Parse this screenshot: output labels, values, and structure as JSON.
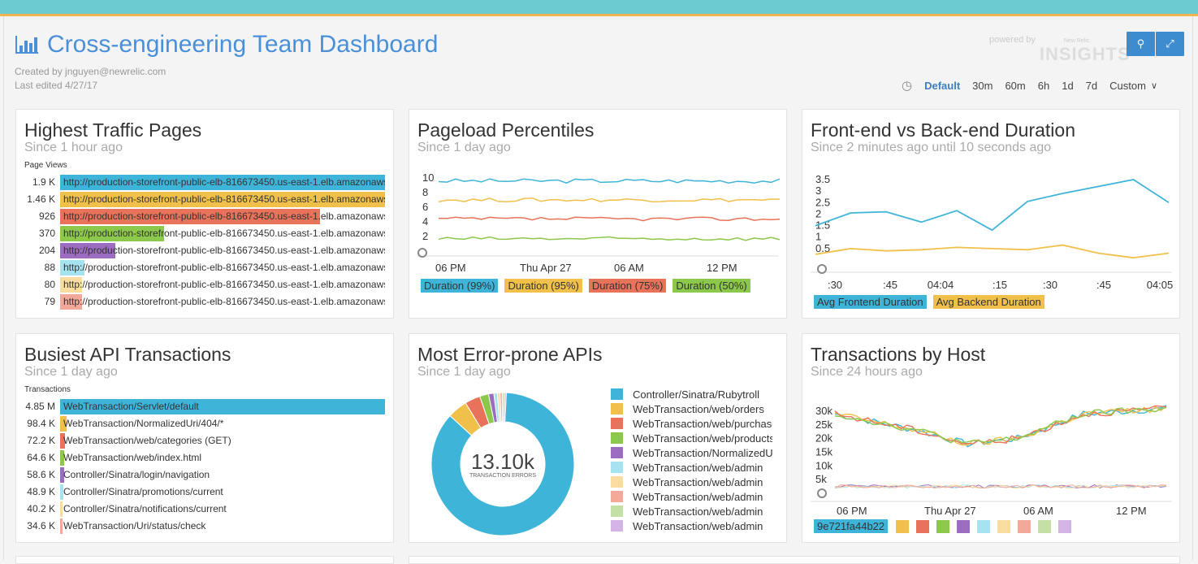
{
  "header": {
    "title": "Cross-engineering Team Dashboard",
    "created_by": "Created by jnguyen@newrelic.com",
    "last_edited": "Last edited 4/27/17",
    "powered_by": "powered by",
    "brand_small": "New Relic.",
    "brand": "INSIGHTS"
  },
  "time_range": {
    "options": [
      "Default",
      "30m",
      "60m",
      "6h",
      "1d",
      "7d",
      "Custom"
    ],
    "selected": "Default"
  },
  "colors": {
    "accent": "#4a90d9",
    "teal": "#6ccbd0",
    "series": [
      "#3fb4d9",
      "#f0c04a",
      "#e8735a",
      "#8cc84b",
      "#9b6cbf",
      "#a6e3f0",
      "#f8dca0",
      "#f2a99a",
      "#c5e0a5",
      "#d4b4e4"
    ]
  },
  "panels": {
    "traffic": {
      "title": "Highest Traffic Pages",
      "subtitle": "Since 1 hour ago",
      "column_label": "Page Views",
      "rows": [
        {
          "value": "1.9 K",
          "label": "http://production-storefront-public-elb-816673450.us-east-1.elb.amazonaws.com",
          "fraction": 1.0
        },
        {
          "value": "1.46 K",
          "label": "http://production-storefront-public-elb-816673450.us-east-1.elb.amazonaws.com",
          "fraction": 1.0
        },
        {
          "value": "926",
          "label": "http://production-storefront-public-elb-816673450.us-east-1.elb.amazonaws.com",
          "fraction": 0.8
        },
        {
          "value": "370",
          "label": "http://production-storefront-public-elb-816673450.us-east-1.elb.amazonaws.com",
          "fraction": 0.32
        },
        {
          "value": "204",
          "label": "http://production-storefront-public-elb-816673450.us-east-1.elb.amazonaws.com",
          "fraction": 0.17
        },
        {
          "value": "88",
          "label": "http://production-storefront-public-elb-816673450.us-east-1.elb.amazonaws.com",
          "fraction": 0.075
        },
        {
          "value": "80",
          "label": "http://production-storefront-public-elb-816673450.us-east-1.elb.amazonaws.com",
          "fraction": 0.068
        },
        {
          "value": "79",
          "label": "http://production-storefront-public-elb-816673450.us-east-1.elb.amazonaws.com",
          "fraction": 0.067
        }
      ]
    },
    "pageload": {
      "title": "Pageload Percentiles",
      "subtitle": "Since 1 day ago",
      "y_ticks": [
        "10",
        "8",
        "6",
        "4",
        "2"
      ],
      "x_ticks": [
        "06 PM",
        "Thu Apr 27",
        "06 AM",
        "12 PM"
      ],
      "legend": [
        "Duration (99%)",
        "Duration (95%)",
        "Duration (75%)",
        "Duration (50%)"
      ],
      "levels": [
        9.6,
        7.0,
        4.4,
        1.7
      ]
    },
    "frontback": {
      "title": "Front-end vs Back-end Duration",
      "subtitle": "Since 2 minutes ago until 10 seconds ago",
      "y_ticks": [
        "3.5",
        "3",
        "2.5",
        "2",
        "1.5",
        "1",
        "0.5"
      ],
      "x_ticks": [
        ":30",
        ":45",
        "04:04",
        ":15",
        ":30",
        ":45",
        "04:05"
      ],
      "legend": [
        "Avg Frontend Duration",
        "Avg Backend Duration"
      ],
      "frontend": [
        1.5,
        2.05,
        2.1,
        1.65,
        2.15,
        1.3,
        2.55,
        2.9,
        3.2,
        3.5,
        2.5
      ],
      "backend": [
        0.25,
        0.5,
        0.4,
        0.45,
        0.55,
        0.5,
        0.45,
        0.65,
        0.3,
        0.1,
        0.3
      ]
    },
    "api": {
      "title": "Busiest API Transactions",
      "subtitle": "Since 1 day ago",
      "column_label": "Transactions",
      "rows": [
        {
          "value": "4.85 M",
          "label": "WebTransaction/Servlet/default",
          "fraction": 1.0
        },
        {
          "value": "98.4 K",
          "label": "WebTransaction/NormalizedUri/404/*",
          "fraction": 0.02
        },
        {
          "value": "72.2 K",
          "label": "WebTransaction/web/categories (GET)",
          "fraction": 0.015
        },
        {
          "value": "64.6 K",
          "label": "WebTransaction/web/index.html",
          "fraction": 0.013
        },
        {
          "value": "58.6 K",
          "label": "Controller/Sinatra/login/navigation",
          "fraction": 0.012
        },
        {
          "value": "48.9 K",
          "label": "Controller/Sinatra/promotions/current",
          "fraction": 0.01
        },
        {
          "value": "40.2 K",
          "label": "Controller/Sinatra/notifications/current",
          "fraction": 0.008
        },
        {
          "value": "34.6 K",
          "label": "WebTransaction/Uri/status/check",
          "fraction": 0.007
        }
      ]
    },
    "errors": {
      "title": "Most Error-prone APIs",
      "subtitle": "Since 1 day ago",
      "total": "13.10k",
      "total_label": "TRANSACTION ERRORS",
      "items": [
        {
          "label": "Controller/Sinatra/Rubytroll",
          "share": 0.86
        },
        {
          "label": "WebTransaction/web/orders",
          "share": 0.045
        },
        {
          "label": "WebTransaction/web/purchase",
          "share": 0.035
        },
        {
          "label": "WebTransaction/web/products",
          "share": 0.02
        },
        {
          "label": "WebTransaction/NormalizedUri",
          "share": 0.012
        },
        {
          "label": "WebTransaction/web/admin",
          "share": 0.008
        },
        {
          "label": "WebTransaction/web/admin",
          "share": 0.006
        },
        {
          "label": "WebTransaction/web/admin",
          "share": 0.005
        },
        {
          "label": "WebTransaction/web/admin",
          "share": 0.005
        },
        {
          "label": "WebTransaction/web/admin",
          "share": 0.004
        }
      ]
    },
    "hosts": {
      "title": "Transactions by Host",
      "subtitle": "Since 24 hours ago",
      "y_ticks": [
        "30k",
        "25k",
        "20k",
        "15k",
        "10k",
        "5k"
      ],
      "x_ticks": [
        "06 PM",
        "Thu Apr 27",
        "06 AM",
        "12 PM"
      ],
      "legend_first": "9e721fa44b22"
    }
  }
}
